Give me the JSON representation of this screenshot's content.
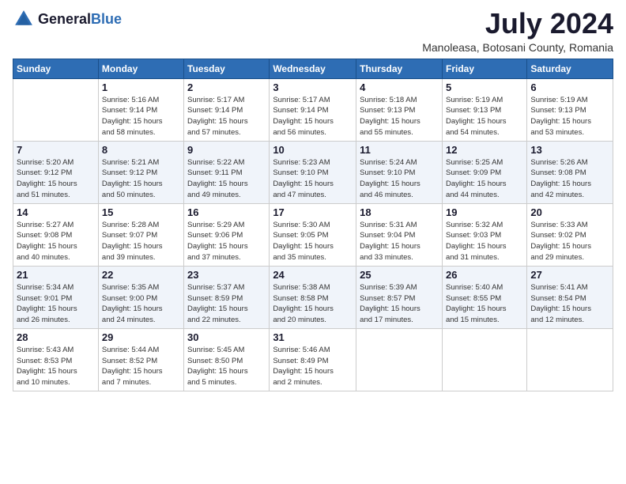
{
  "logo": {
    "general": "General",
    "blue": "Blue"
  },
  "title": {
    "month_year": "July 2024",
    "location": "Manoleasa, Botosani County, Romania"
  },
  "headers": [
    "Sunday",
    "Monday",
    "Tuesday",
    "Wednesday",
    "Thursday",
    "Friday",
    "Saturday"
  ],
  "weeks": [
    [
      {
        "day": "",
        "info": ""
      },
      {
        "day": "1",
        "info": "Sunrise: 5:16 AM\nSunset: 9:14 PM\nDaylight: 15 hours\nand 58 minutes."
      },
      {
        "day": "2",
        "info": "Sunrise: 5:17 AM\nSunset: 9:14 PM\nDaylight: 15 hours\nand 57 minutes."
      },
      {
        "day": "3",
        "info": "Sunrise: 5:17 AM\nSunset: 9:14 PM\nDaylight: 15 hours\nand 56 minutes."
      },
      {
        "day": "4",
        "info": "Sunrise: 5:18 AM\nSunset: 9:13 PM\nDaylight: 15 hours\nand 55 minutes."
      },
      {
        "day": "5",
        "info": "Sunrise: 5:19 AM\nSunset: 9:13 PM\nDaylight: 15 hours\nand 54 minutes."
      },
      {
        "day": "6",
        "info": "Sunrise: 5:19 AM\nSunset: 9:13 PM\nDaylight: 15 hours\nand 53 minutes."
      }
    ],
    [
      {
        "day": "7",
        "info": "Sunrise: 5:20 AM\nSunset: 9:12 PM\nDaylight: 15 hours\nand 51 minutes."
      },
      {
        "day": "8",
        "info": "Sunrise: 5:21 AM\nSunset: 9:12 PM\nDaylight: 15 hours\nand 50 minutes."
      },
      {
        "day": "9",
        "info": "Sunrise: 5:22 AM\nSunset: 9:11 PM\nDaylight: 15 hours\nand 49 minutes."
      },
      {
        "day": "10",
        "info": "Sunrise: 5:23 AM\nSunset: 9:10 PM\nDaylight: 15 hours\nand 47 minutes."
      },
      {
        "day": "11",
        "info": "Sunrise: 5:24 AM\nSunset: 9:10 PM\nDaylight: 15 hours\nand 46 minutes."
      },
      {
        "day": "12",
        "info": "Sunrise: 5:25 AM\nSunset: 9:09 PM\nDaylight: 15 hours\nand 44 minutes."
      },
      {
        "day": "13",
        "info": "Sunrise: 5:26 AM\nSunset: 9:08 PM\nDaylight: 15 hours\nand 42 minutes."
      }
    ],
    [
      {
        "day": "14",
        "info": "Sunrise: 5:27 AM\nSunset: 9:08 PM\nDaylight: 15 hours\nand 40 minutes."
      },
      {
        "day": "15",
        "info": "Sunrise: 5:28 AM\nSunset: 9:07 PM\nDaylight: 15 hours\nand 39 minutes."
      },
      {
        "day": "16",
        "info": "Sunrise: 5:29 AM\nSunset: 9:06 PM\nDaylight: 15 hours\nand 37 minutes."
      },
      {
        "day": "17",
        "info": "Sunrise: 5:30 AM\nSunset: 9:05 PM\nDaylight: 15 hours\nand 35 minutes."
      },
      {
        "day": "18",
        "info": "Sunrise: 5:31 AM\nSunset: 9:04 PM\nDaylight: 15 hours\nand 33 minutes."
      },
      {
        "day": "19",
        "info": "Sunrise: 5:32 AM\nSunset: 9:03 PM\nDaylight: 15 hours\nand 31 minutes."
      },
      {
        "day": "20",
        "info": "Sunrise: 5:33 AM\nSunset: 9:02 PM\nDaylight: 15 hours\nand 29 minutes."
      }
    ],
    [
      {
        "day": "21",
        "info": "Sunrise: 5:34 AM\nSunset: 9:01 PM\nDaylight: 15 hours\nand 26 minutes."
      },
      {
        "day": "22",
        "info": "Sunrise: 5:35 AM\nSunset: 9:00 PM\nDaylight: 15 hours\nand 24 minutes."
      },
      {
        "day": "23",
        "info": "Sunrise: 5:37 AM\nSunset: 8:59 PM\nDaylight: 15 hours\nand 22 minutes."
      },
      {
        "day": "24",
        "info": "Sunrise: 5:38 AM\nSunset: 8:58 PM\nDaylight: 15 hours\nand 20 minutes."
      },
      {
        "day": "25",
        "info": "Sunrise: 5:39 AM\nSunset: 8:57 PM\nDaylight: 15 hours\nand 17 minutes."
      },
      {
        "day": "26",
        "info": "Sunrise: 5:40 AM\nSunset: 8:55 PM\nDaylight: 15 hours\nand 15 minutes."
      },
      {
        "day": "27",
        "info": "Sunrise: 5:41 AM\nSunset: 8:54 PM\nDaylight: 15 hours\nand 12 minutes."
      }
    ],
    [
      {
        "day": "28",
        "info": "Sunrise: 5:43 AM\nSunset: 8:53 PM\nDaylight: 15 hours\nand 10 minutes."
      },
      {
        "day": "29",
        "info": "Sunrise: 5:44 AM\nSunset: 8:52 PM\nDaylight: 15 hours\nand 7 minutes."
      },
      {
        "day": "30",
        "info": "Sunrise: 5:45 AM\nSunset: 8:50 PM\nDaylight: 15 hours\nand 5 minutes."
      },
      {
        "day": "31",
        "info": "Sunrise: 5:46 AM\nSunset: 8:49 PM\nDaylight: 15 hours\nand 2 minutes."
      },
      {
        "day": "",
        "info": ""
      },
      {
        "day": "",
        "info": ""
      },
      {
        "day": "",
        "info": ""
      }
    ]
  ]
}
